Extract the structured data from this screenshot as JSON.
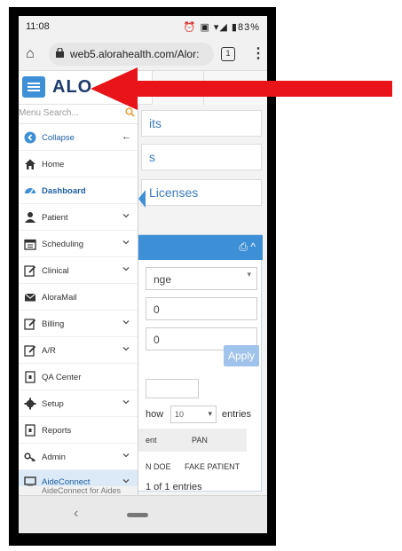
{
  "status_bar": {
    "time": "11:08",
    "icons": "⏰ ▣ ▾◢ ▮83%"
  },
  "browser": {
    "url": "web5.alorahealth.com/Alor:",
    "tab_count": "1"
  },
  "app": {
    "logo": "ALO"
  },
  "main": {
    "cards": [
      "its",
      "s",
      "Licenses"
    ],
    "panel_icons": "⎙ ^",
    "select1": "nge",
    "input2": "0",
    "input3": "0",
    "apply_label": "Apply",
    "show_label": "how",
    "entries_value": "10",
    "entries_label": "entries",
    "col1": "ent",
    "col2": "PAN",
    "row_name": "N DOE",
    "row_pan": "FAKE PATIENT",
    "footer_text": "1 of 1 entries"
  },
  "sidebar": {
    "search_placeholder": "Menu Search...",
    "items": [
      {
        "label": "Collapse",
        "icon": "collapse-icon"
      },
      {
        "label": "Home",
        "icon": "home-icon"
      },
      {
        "label": "Dashboard",
        "icon": "dashboard-icon"
      },
      {
        "label": "Patient",
        "icon": "person-icon"
      },
      {
        "label": "Scheduling",
        "icon": "calendar-icon"
      },
      {
        "label": "Clinical",
        "icon": "edit-icon"
      },
      {
        "label": "AloraMail",
        "icon": "mail-icon"
      },
      {
        "label": "Billing",
        "icon": "edit-icon"
      },
      {
        "label": "A/R",
        "icon": "edit-icon"
      },
      {
        "label": "QA Center",
        "icon": "file-icon"
      },
      {
        "label": "Setup",
        "icon": "gear-icon"
      },
      {
        "label": "Reports",
        "icon": "file-icon"
      },
      {
        "label": "Admin",
        "icon": "key-icon"
      },
      {
        "label": "AideConnect",
        "icon": "monitor-icon"
      }
    ],
    "sub_item": "AideConnect for Aides"
  },
  "colors": {
    "accent": "#3d8fd6",
    "brand": "#1d3b6a",
    "arrow": "#e8141a"
  }
}
